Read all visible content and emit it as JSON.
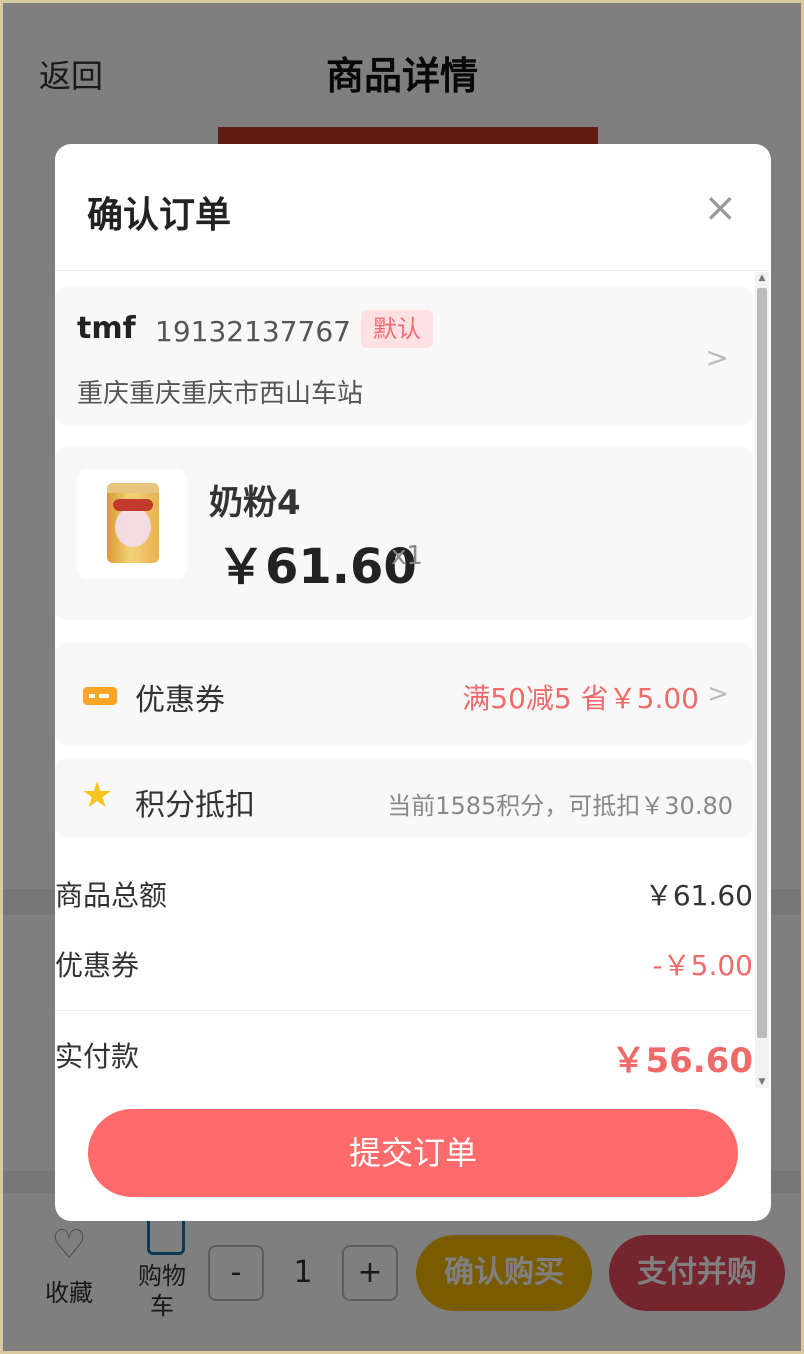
{
  "header": {
    "back_label": "返回",
    "title": "商品详情"
  },
  "bottom_bar": {
    "favorite_label": "收藏",
    "cart_label": "购物车",
    "qty_minus": "-",
    "qty_value": "1",
    "qty_plus": "+",
    "confirm_buy": "确认购买",
    "pay_and_buy": "支付并购"
  },
  "modal": {
    "title": "确认订单",
    "close_glyph": "×",
    "address": {
      "name": "tmf",
      "phone": "19132137767",
      "badge": "默认",
      "line": "重庆重庆重庆市西山车站",
      "arrow": ">"
    },
    "product": {
      "name": "奶粉4",
      "price": "￥61.60",
      "qty": "x1"
    },
    "coupon": {
      "label": "优惠券",
      "value": "满50减5 省￥5.00",
      "arrow": ">"
    },
    "points": {
      "label": "积分抵扣",
      "value": "当前1585积分，可抵扣￥30.80"
    },
    "summary": {
      "goods_total_label": "商品总额",
      "goods_total_value": "￥61.60",
      "coupon_label": "优惠券",
      "coupon_value": "-￥5.00",
      "paid_label": "实付款",
      "paid_value": "￥56.60"
    },
    "submit_label": "提交订单"
  },
  "colors": {
    "accent": "#ff6b6b",
    "price_red": "#f06a6a",
    "confirm_yellow": "#f5b800",
    "pay_red": "#e84b5b"
  }
}
